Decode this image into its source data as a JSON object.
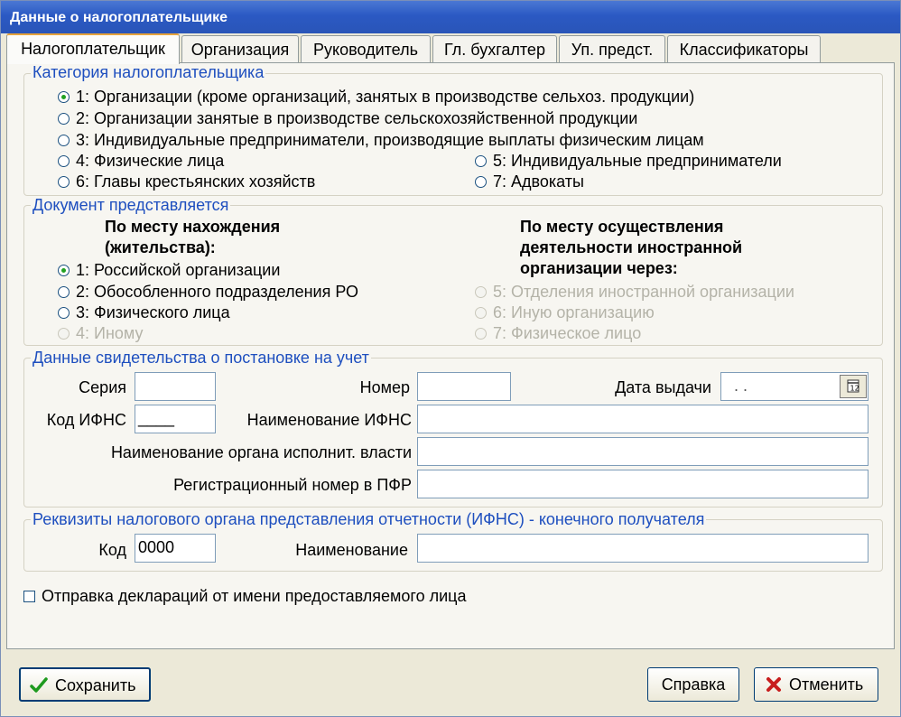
{
  "window": {
    "title": "Данные о налогоплательщике"
  },
  "tabs": [
    {
      "label": "Налогоплательщик"
    },
    {
      "label": "Организация"
    },
    {
      "label": "Руководитель"
    },
    {
      "label": "Гл. бухгалтер"
    },
    {
      "label": "Уп. предст."
    },
    {
      "label": "Классификаторы"
    }
  ],
  "category": {
    "legend": "Категория налогоплательщика",
    "options": [
      {
        "label": "1: Организации (кроме организаций, занятых в производстве сельхоз. продукции)",
        "checked": true
      },
      {
        "label": "2: Организации занятые в производстве сельскохозяйственной продукции",
        "checked": false
      },
      {
        "label": "3: Индивидуальные предприниматели, производящие выплаты физическим лицам",
        "checked": false
      },
      {
        "label": "4: Физические лица",
        "checked": false
      },
      {
        "label": "5: Индивидуальные предприниматели",
        "checked": false
      },
      {
        "label": "6: Главы крестьянских хозяйств",
        "checked": false
      },
      {
        "label": "7: Адвокаты",
        "checked": false
      }
    ]
  },
  "document": {
    "legend": "Документ представляется",
    "left_heading_1": "По месту нахождения",
    "left_heading_2": "(жительства):",
    "right_heading_1": "По месту осуществления",
    "right_heading_2": "деятельности иностранной",
    "right_heading_3": "организации  через:",
    "options": [
      {
        "label": "1: Российской организации",
        "checked": true,
        "disabled": false
      },
      {
        "label": "2: Обособленного подразделения РО",
        "checked": false,
        "disabled": false
      },
      {
        "label": "3: Физического лица",
        "checked": false,
        "disabled": false
      },
      {
        "label": "4: Иному",
        "checked": false,
        "disabled": true
      },
      {
        "label": "5: Отделения иностранной организации",
        "checked": false,
        "disabled": true
      },
      {
        "label": "6: Иную организацию",
        "checked": false,
        "disabled": true
      },
      {
        "label": "7: Физическое лицо",
        "checked": false,
        "disabled": true
      }
    ]
  },
  "certificate": {
    "legend": "Данные свидетельства о постановке на учет",
    "series_label": "Серия",
    "series_value": "",
    "number_label": "Номер",
    "number_value": "",
    "date_label": "Дата выдачи",
    "date_value": ". .",
    "ifns_code_label": "Код ИФНС",
    "ifns_code_value": "____",
    "ifns_name_label": "Наименование ИФНС",
    "ifns_name_value": "",
    "authority_label": "Наименование органа исполнит. власти",
    "authority_value": "",
    "pfr_label": "Регистрационный номер  в ПФР",
    "pfr_value": ""
  },
  "recipient": {
    "legend": "Реквизиты налогового органа представления отчетности (ИФНС) - конечного получателя",
    "code_label": "Код",
    "code_value": "0000",
    "name_label": "Наименование",
    "name_value": ""
  },
  "send_on_behalf": {
    "label": "Отправка деклараций от имени предоставляемого лица",
    "checked": false
  },
  "buttons": {
    "save": "Сохранить",
    "help": "Справка",
    "cancel": "Отменить"
  },
  "colors": {
    "legend": "#1e4fbf",
    "titlebar": "#2b59c3",
    "tab_highlight": "#e6a33c",
    "check_green": "#1e9a1e",
    "cancel_red": "#c81e1e"
  }
}
